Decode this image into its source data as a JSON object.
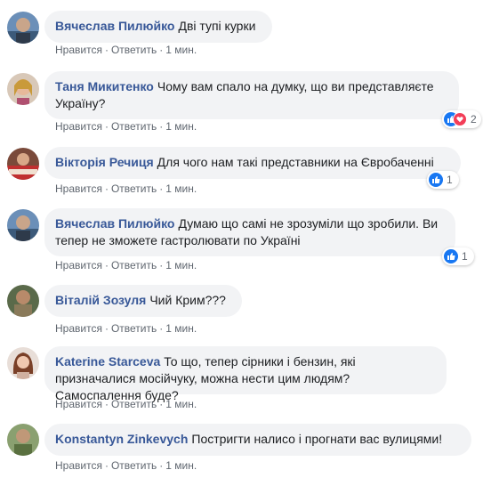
{
  "actions": {
    "like": "Нравится",
    "reply": "Ответить",
    "time": "1 мин.",
    "sep": "·"
  },
  "comments": [
    {
      "author": "Вячеслав Пилюйко",
      "text": "Дві тупі курки",
      "reactions": null
    },
    {
      "author": "Таня Микитенко",
      "text": "Чому вам спало на думку, що ви представляєте Україну?",
      "reactions": "2"
    },
    {
      "author": "Вікторія Речиця",
      "text": "Для чого нам такі представники на Євробаченні",
      "reactions": "1"
    },
    {
      "author": "Вячеслав Пилюйко",
      "text": "Думаю що самі не зрозуміли що зробили. Ви тепер не зможете гастролювати по Україні",
      "reactions": "1"
    },
    {
      "author": "Віталій Зозуля",
      "text": "Чий Крим???",
      "reactions": null
    },
    {
      "author": "Katerine Starceva",
      "text": "То що, тепер сірники і бензин, які призначалися мосійчуку, можна нести цим людям? Самоспалення буде?",
      "reactions": null
    },
    {
      "author": "Konstantyn Zinkevych",
      "text": "Постригти налисо і прогнати вас вулицями!",
      "reactions": null
    }
  ],
  "colors": {
    "author": "#385898",
    "bubble": "#f2f3f5",
    "meta": "#606770",
    "like": "#1877f2",
    "love": "#f33e58"
  }
}
